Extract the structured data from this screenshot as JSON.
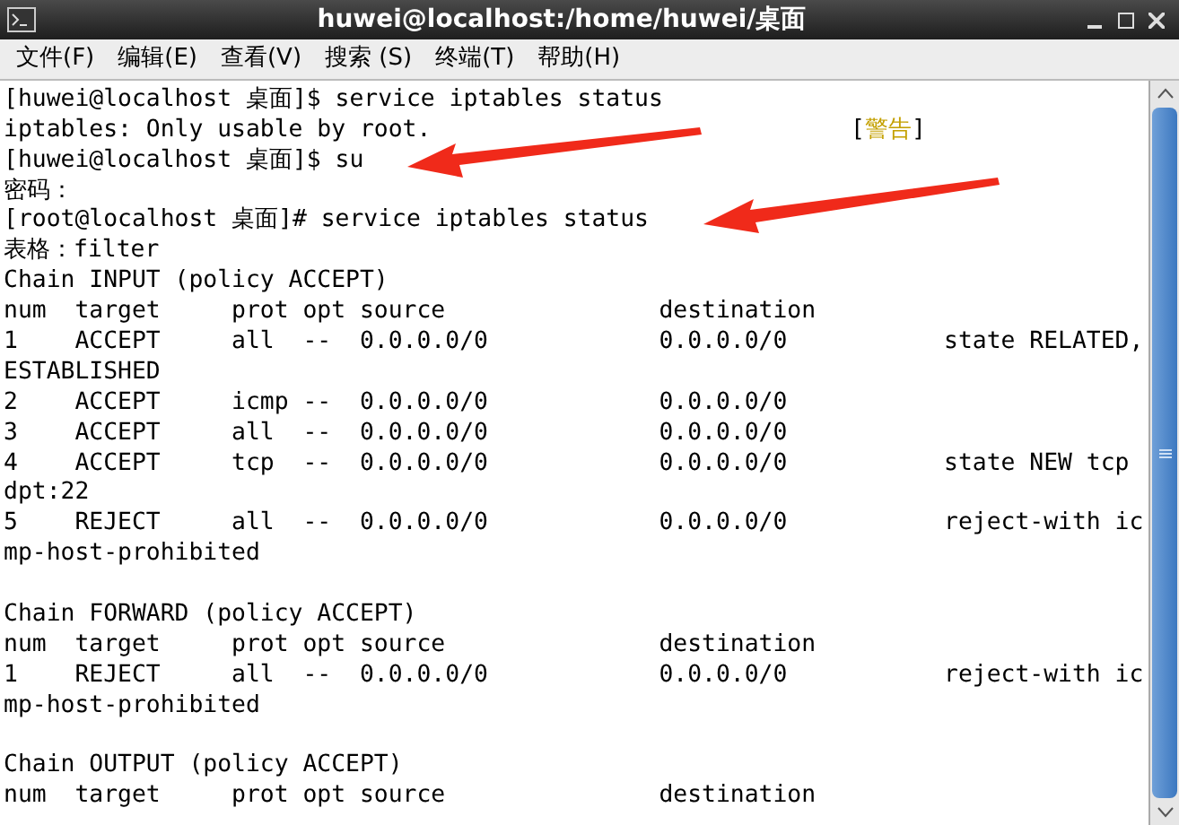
{
  "window": {
    "title": "huwei@localhost:/home/huwei/桌面"
  },
  "menu": [
    "文件(F)",
    "编辑(E)",
    "查看(V)",
    "搜索 (S)",
    "终端(T)",
    "帮助(H)"
  ],
  "terminal": {
    "lines": [
      {
        "kind": "line",
        "text": "[huwei@localhost 桌面]$ service iptables status"
      },
      {
        "kind": "warning",
        "text": "iptables: Only usable by root.",
        "tag_open": "[",
        "tag": "警告",
        "tag_close": "]"
      },
      {
        "kind": "line",
        "text": "[huwei@localhost 桌面]$ su"
      },
      {
        "kind": "line",
        "text": "密码："
      },
      {
        "kind": "line",
        "text": "[root@localhost 桌面]# service iptables status"
      },
      {
        "kind": "line",
        "text": "表格：filter"
      },
      {
        "kind": "line",
        "text": "Chain INPUT (policy ACCEPT)"
      },
      {
        "kind": "line",
        "text": "num  target     prot opt source               destination"
      },
      {
        "kind": "line",
        "text": "1    ACCEPT     all  --  0.0.0.0/0            0.0.0.0/0           state RELATED,"
      },
      {
        "kind": "line",
        "text": "ESTABLISHED"
      },
      {
        "kind": "line",
        "text": "2    ACCEPT     icmp --  0.0.0.0/0            0.0.0.0/0"
      },
      {
        "kind": "line",
        "text": "3    ACCEPT     all  --  0.0.0.0/0            0.0.0.0/0"
      },
      {
        "kind": "line",
        "text": "4    ACCEPT     tcp  --  0.0.0.0/0            0.0.0.0/0           state NEW tcp"
      },
      {
        "kind": "line",
        "text": "dpt:22"
      },
      {
        "kind": "line",
        "text": "5    REJECT     all  --  0.0.0.0/0            0.0.0.0/0           reject-with ic"
      },
      {
        "kind": "line",
        "text": "mp-host-prohibited"
      },
      {
        "kind": "blank"
      },
      {
        "kind": "line",
        "text": "Chain FORWARD (policy ACCEPT)"
      },
      {
        "kind": "line",
        "text": "num  target     prot opt source               destination"
      },
      {
        "kind": "line",
        "text": "1    REJECT     all  --  0.0.0.0/0            0.0.0.0/0           reject-with ic"
      },
      {
        "kind": "line",
        "text": "mp-host-prohibited"
      },
      {
        "kind": "blank"
      },
      {
        "kind": "line",
        "text": "Chain OUTPUT (policy ACCEPT)"
      },
      {
        "kind": "line",
        "text": "num  target     prot opt source               destination"
      }
    ]
  }
}
